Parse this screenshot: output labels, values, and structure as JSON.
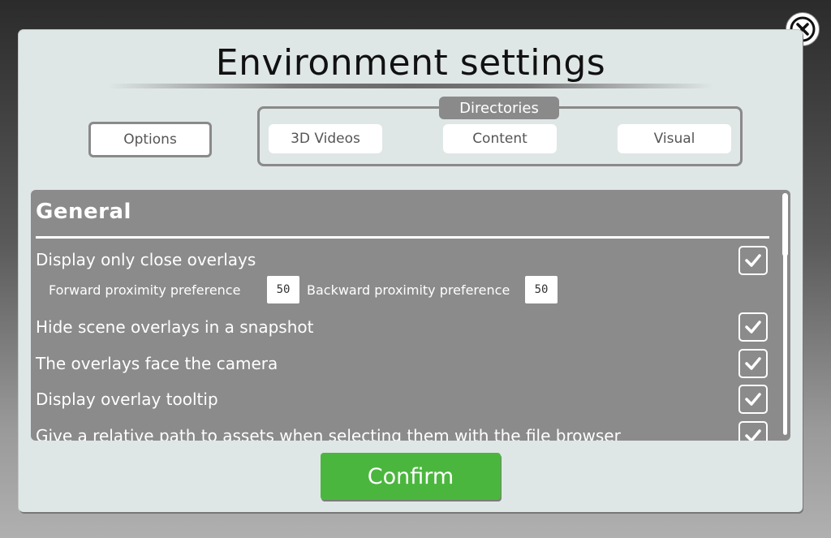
{
  "dialog": {
    "title": "Environment settings",
    "close_icon": "close-circle-icon"
  },
  "tabs": {
    "options_label": "Options",
    "directories_label": "Directories",
    "directories": [
      "3D Videos",
      "Content",
      "Visual"
    ]
  },
  "general": {
    "title": "General",
    "rows": [
      {
        "label": "Display only close overlays",
        "checked": true
      },
      {
        "label": "Hide scene overlays in a snapshot",
        "checked": true
      },
      {
        "label": "The overlays face the camera",
        "checked": true
      },
      {
        "label": "Display overlay tooltip",
        "checked": true
      },
      {
        "label": "Give a relative path to assets when selecting them with the file browser",
        "checked": true
      }
    ],
    "forward_label": "Forward proximity preference",
    "forward_value": "50",
    "backward_label": "Backward proximity preference",
    "backward_value": "50"
  },
  "confirm_label": "Confirm",
  "colors": {
    "confirm": "#4bb63e",
    "panel": "#8b8b8b",
    "dialog": "#dfe6e6"
  }
}
